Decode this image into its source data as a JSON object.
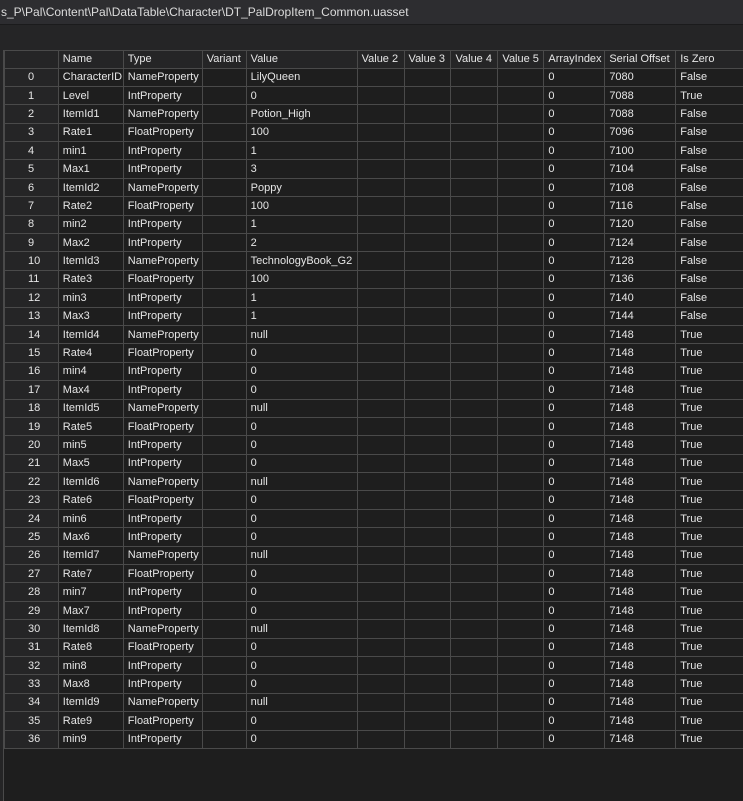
{
  "window": {
    "title": "s_P\\Pal\\Content\\Pal\\DataTable\\Character\\DT_PalDropItem_Common.uasset"
  },
  "table": {
    "columns": [
      "",
      "Name",
      "Type",
      "Variant",
      "Value",
      "Value 2",
      "Value 3",
      "Value 4",
      "Value 5",
      "ArrayIndex",
      "Serial Offset",
      "Is Zero"
    ],
    "rows": [
      [
        "0",
        "CharacterID",
        "NameProperty",
        "",
        "LilyQueen",
        "",
        "",
        "",
        "",
        "0",
        "7080",
        "False"
      ],
      [
        "1",
        "Level",
        "IntProperty",
        "",
        "0",
        "",
        "",
        "",
        "",
        "0",
        "7088",
        "True"
      ],
      [
        "2",
        "ItemId1",
        "NameProperty",
        "",
        "Potion_High",
        "",
        "",
        "",
        "",
        "0",
        "7088",
        "False"
      ],
      [
        "3",
        "Rate1",
        "FloatProperty",
        "",
        "100",
        "",
        "",
        "",
        "",
        "0",
        "7096",
        "False"
      ],
      [
        "4",
        "min1",
        "IntProperty",
        "",
        "1",
        "",
        "",
        "",
        "",
        "0",
        "7100",
        "False"
      ],
      [
        "5",
        "Max1",
        "IntProperty",
        "",
        "3",
        "",
        "",
        "",
        "",
        "0",
        "7104",
        "False"
      ],
      [
        "6",
        "ItemId2",
        "NameProperty",
        "",
        "Poppy",
        "",
        "",
        "",
        "",
        "0",
        "7108",
        "False"
      ],
      [
        "7",
        "Rate2",
        "FloatProperty",
        "",
        "100",
        "",
        "",
        "",
        "",
        "0",
        "7116",
        "False"
      ],
      [
        "8",
        "min2",
        "IntProperty",
        "",
        "1",
        "",
        "",
        "",
        "",
        "0",
        "7120",
        "False"
      ],
      [
        "9",
        "Max2",
        "IntProperty",
        "",
        "2",
        "",
        "",
        "",
        "",
        "0",
        "7124",
        "False"
      ],
      [
        "10",
        "ItemId3",
        "NameProperty",
        "",
        "TechnologyBook_G2",
        "",
        "",
        "",
        "",
        "0",
        "7128",
        "False"
      ],
      [
        "11",
        "Rate3",
        "FloatProperty",
        "",
        "100",
        "",
        "",
        "",
        "",
        "0",
        "7136",
        "False"
      ],
      [
        "12",
        "min3",
        "IntProperty",
        "",
        "1",
        "",
        "",
        "",
        "",
        "0",
        "7140",
        "False"
      ],
      [
        "13",
        "Max3",
        "IntProperty",
        "",
        "1",
        "",
        "",
        "",
        "",
        "0",
        "7144",
        "False"
      ],
      [
        "14",
        "ItemId4",
        "NameProperty",
        "",
        "null",
        "",
        "",
        "",
        "",
        "0",
        "7148",
        "True"
      ],
      [
        "15",
        "Rate4",
        "FloatProperty",
        "",
        "0",
        "",
        "",
        "",
        "",
        "0",
        "7148",
        "True"
      ],
      [
        "16",
        "min4",
        "IntProperty",
        "",
        "0",
        "",
        "",
        "",
        "",
        "0",
        "7148",
        "True"
      ],
      [
        "17",
        "Max4",
        "IntProperty",
        "",
        "0",
        "",
        "",
        "",
        "",
        "0",
        "7148",
        "True"
      ],
      [
        "18",
        "ItemId5",
        "NameProperty",
        "",
        "null",
        "",
        "",
        "",
        "",
        "0",
        "7148",
        "True"
      ],
      [
        "19",
        "Rate5",
        "FloatProperty",
        "",
        "0",
        "",
        "",
        "",
        "",
        "0",
        "7148",
        "True"
      ],
      [
        "20",
        "min5",
        "IntProperty",
        "",
        "0",
        "",
        "",
        "",
        "",
        "0",
        "7148",
        "True"
      ],
      [
        "21",
        "Max5",
        "IntProperty",
        "",
        "0",
        "",
        "",
        "",
        "",
        "0",
        "7148",
        "True"
      ],
      [
        "22",
        "ItemId6",
        "NameProperty",
        "",
        "null",
        "",
        "",
        "",
        "",
        "0",
        "7148",
        "True"
      ],
      [
        "23",
        "Rate6",
        "FloatProperty",
        "",
        "0",
        "",
        "",
        "",
        "",
        "0",
        "7148",
        "True"
      ],
      [
        "24",
        "min6",
        "IntProperty",
        "",
        "0",
        "",
        "",
        "",
        "",
        "0",
        "7148",
        "True"
      ],
      [
        "25",
        "Max6",
        "IntProperty",
        "",
        "0",
        "",
        "",
        "",
        "",
        "0",
        "7148",
        "True"
      ],
      [
        "26",
        "ItemId7",
        "NameProperty",
        "",
        "null",
        "",
        "",
        "",
        "",
        "0",
        "7148",
        "True"
      ],
      [
        "27",
        "Rate7",
        "FloatProperty",
        "",
        "0",
        "",
        "",
        "",
        "",
        "0",
        "7148",
        "True"
      ],
      [
        "28",
        "min7",
        "IntProperty",
        "",
        "0",
        "",
        "",
        "",
        "",
        "0",
        "7148",
        "True"
      ],
      [
        "29",
        "Max7",
        "IntProperty",
        "",
        "0",
        "",
        "",
        "",
        "",
        "0",
        "7148",
        "True"
      ],
      [
        "30",
        "ItemId8",
        "NameProperty",
        "",
        "null",
        "",
        "",
        "",
        "",
        "0",
        "7148",
        "True"
      ],
      [
        "31",
        "Rate8",
        "FloatProperty",
        "",
        "0",
        "",
        "",
        "",
        "",
        "0",
        "7148",
        "True"
      ],
      [
        "32",
        "min8",
        "IntProperty",
        "",
        "0",
        "",
        "",
        "",
        "",
        "0",
        "7148",
        "True"
      ],
      [
        "33",
        "Max8",
        "IntProperty",
        "",
        "0",
        "",
        "",
        "",
        "",
        "0",
        "7148",
        "True"
      ],
      [
        "34",
        "ItemId9",
        "NameProperty",
        "",
        "null",
        "",
        "",
        "",
        "",
        "0",
        "7148",
        "True"
      ],
      [
        "35",
        "Rate9",
        "FloatProperty",
        "",
        "0",
        "",
        "",
        "",
        "",
        "0",
        "7148",
        "True"
      ],
      [
        "36",
        "min9",
        "IntProperty",
        "",
        "0",
        "",
        "",
        "",
        "",
        "0",
        "7148",
        "True"
      ]
    ]
  },
  "colors": {
    "background": "#1e1e1e",
    "header": "#252526",
    "gridline": "#4a4a4a",
    "text": "#e6e6e6"
  }
}
